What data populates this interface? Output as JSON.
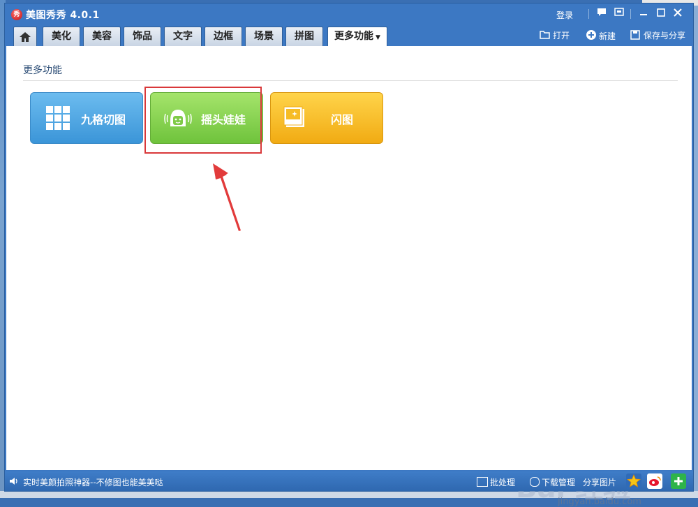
{
  "window": {
    "app_icon_text": "秀",
    "title": "美图秀秀 4.0.1",
    "login": "登录"
  },
  "tabs": [
    {
      "label": "",
      "icon": "home-icon"
    },
    {
      "label": "美化"
    },
    {
      "label": "美容"
    },
    {
      "label": "饰品"
    },
    {
      "label": "文字"
    },
    {
      "label": "边框"
    },
    {
      "label": "场景"
    },
    {
      "label": "拼图"
    },
    {
      "label": "更多功能",
      "active": true
    }
  ],
  "toolbar": {
    "open": "打开",
    "new": "新建",
    "save_share": "保存与分享"
  },
  "content": {
    "section_title": "更多功能",
    "tiles": [
      {
        "label": "九格切图",
        "icon": "grid-icon",
        "color": "#4aa5e0"
      },
      {
        "label": "摇头娃娃",
        "icon": "doll-head-icon",
        "color": "#86d24f"
      },
      {
        "label": "闪图",
        "icon": "sparkle-photo-icon",
        "color": "#f6bc25"
      }
    ]
  },
  "statusbar": {
    "message": "实时美颜拍照神器--不修图也能美美哒",
    "batch": "批处理",
    "download": "下载管理",
    "share_image": "分享图片"
  },
  "watermark": {
    "brand": "Bai 经验",
    "url": "jingyan.baidu.com"
  },
  "colors": {
    "window_blue": "#3c78c3",
    "highlight_red": "#d9383a"
  }
}
